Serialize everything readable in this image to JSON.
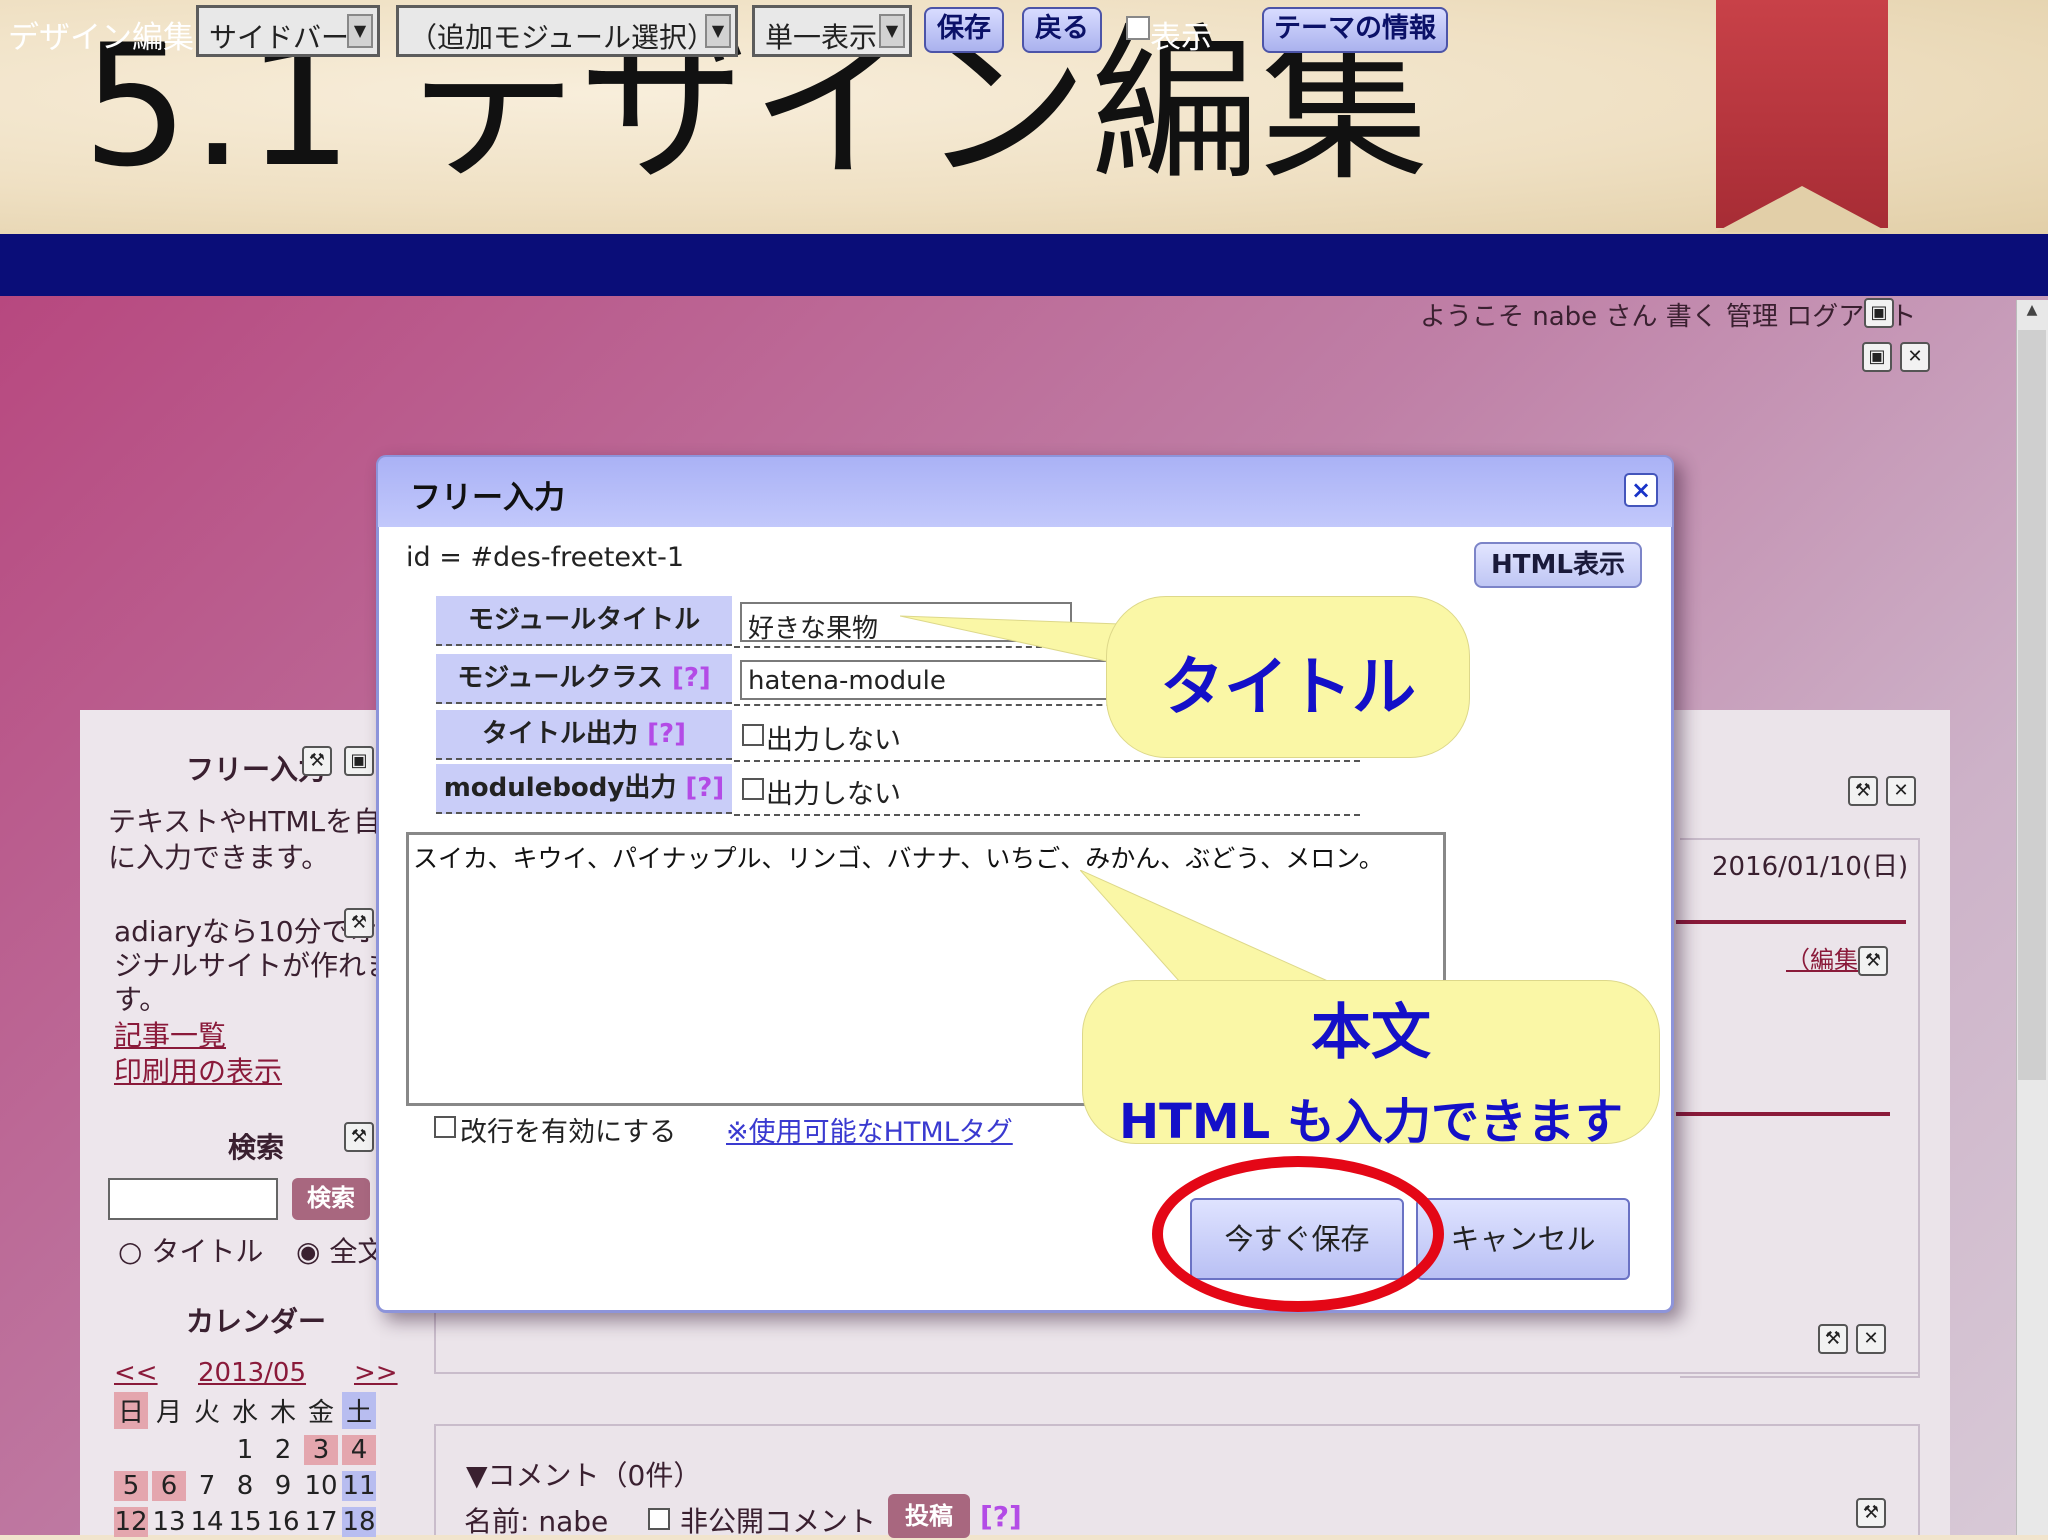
{
  "slide": {
    "title": "5.1 デザイン編集"
  },
  "toolbar": {
    "label": "デザイン編集",
    "select_sidebar": "サイドバー",
    "select_module": "（追加モジュール選択）",
    "select_view": "単一表示",
    "save": "保存",
    "back": "戻る",
    "show_label": "表示",
    "theme_info": "テーマの情報",
    "arrow": "▼"
  },
  "page": {
    "welcome": "ようこそ nabe さん 書く 管理 ログアウト",
    "sidebar": {
      "freetext_heading": "フリー入力",
      "freetext_body_1": "テキストやHTMLを自由",
      "freetext_body_2": "に入力できます。",
      "adiary_1": "adiaryなら10分でオリ",
      "adiary_2": "ジナルサイトが作れま",
      "adiary_3": "す。",
      "link_articles": "記事一覧",
      "link_print": "印刷用の表示",
      "search_heading": "検索",
      "search_button": "検索",
      "radio_title": "タイトル",
      "radio_full": "全文",
      "calendar_heading": "カレンダー",
      "cal_prev": "<<",
      "cal_month": "2013/05",
      "cal_next": ">>",
      "weekdays": [
        "日",
        "月",
        "火",
        "水",
        "木",
        "金",
        "土"
      ],
      "row1": [
        "",
        "",
        "",
        "",
        "1",
        "2",
        "3",
        "4"
      ],
      "row2": [
        "5",
        "6",
        "7",
        "8",
        "9",
        "10",
        "11"
      ],
      "row3": [
        "12",
        "13",
        "14",
        "15",
        "16",
        "17",
        "18"
      ]
    },
    "date": "2016/01/10(日)",
    "edit_link": "（編集）",
    "comment_heading": "▼コメント（0件）",
    "comment_name": "名前: nabe",
    "comment_private": "非公開コメント",
    "comment_post": "投稿",
    "comment_help": "[?]"
  },
  "dialog": {
    "title": "フリー入力",
    "close": "×",
    "id_text": "id = #des-freetext-1",
    "html_button": "HTML表示",
    "module_title_label": "モジュールタイトル",
    "module_title_value": "好きな果物",
    "module_class_label": "モジュールクラス",
    "module_class_value": "hatena-module",
    "title_output_label": "タイトル出力",
    "modulebody_output_label": "modulebody出力",
    "help": "[?]",
    "no_output": "出力しない",
    "body_text": "スイカ、キウイ、パイナップル、リンゴ、バナナ、いちご、みかん、ぶどう、メロン。",
    "linebreak_label": "改行を有効にする",
    "html_tags_link": "※使用可能なHTMLタグ",
    "save_now": "今すぐ保存",
    "cancel": "キャンセル"
  },
  "callouts": {
    "title": "タイトル",
    "body_main": "本文",
    "body_sub": "HTML も入力できます"
  },
  "colors": {
    "toolbar_bg": "#0a0d78",
    "dialog_header": "#aab2f6",
    "callout_bg": "#faf7a6",
    "callout_text": "#1410c8",
    "highlight_ellipse": "#e40716"
  }
}
